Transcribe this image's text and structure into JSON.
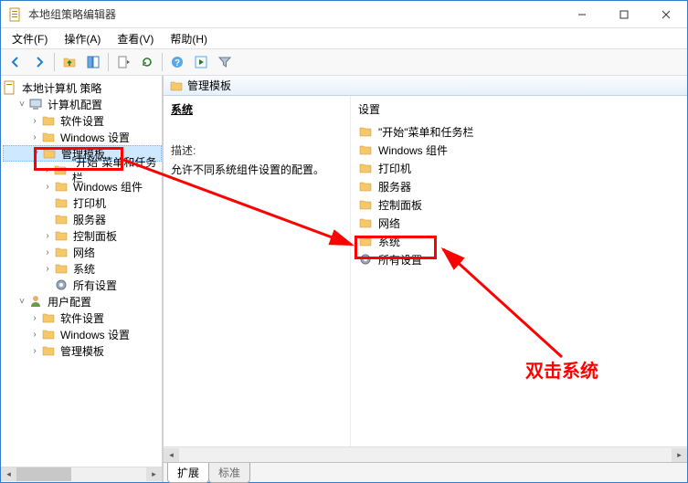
{
  "window": {
    "title": "本地组策略编辑器"
  },
  "menu": {
    "file": "文件(F)",
    "action": "操作(A)",
    "view": "查看(V)",
    "help": "帮助(H)"
  },
  "tree": {
    "root": "本地计算机 策略",
    "computer_config": "计算机配置",
    "software_settings": "软件设置",
    "windows_settings": "Windows 设置",
    "admin_templates": "管理模板",
    "start_taskbar": "\"开始\"菜单和任务栏",
    "windows_components": "Windows 组件",
    "printer": "打印机",
    "server": "服务器",
    "control_panel": "控制面板",
    "network": "网络",
    "system": "系统",
    "all_settings": "所有设置",
    "user_config": "用户配置",
    "u_software": "软件设置",
    "u_windows": "Windows 设置",
    "u_admin": "管理模板"
  },
  "right": {
    "path": "管理模板",
    "section": "系统",
    "desc_label": "描述:",
    "desc_text": "允许不同系统组件设置的配置。",
    "settings_header": "设置",
    "items": {
      "start_taskbar": "\"开始\"菜单和任务栏",
      "windows_components": "Windows 组件",
      "printer": "打印机",
      "server": "服务器",
      "control_panel": "控制面板",
      "network": "网络",
      "system": "系统",
      "all_settings": "所有设置"
    }
  },
  "tabs": {
    "extended": "扩展",
    "standard": "标准"
  },
  "annotation": {
    "text": "双击系统"
  }
}
